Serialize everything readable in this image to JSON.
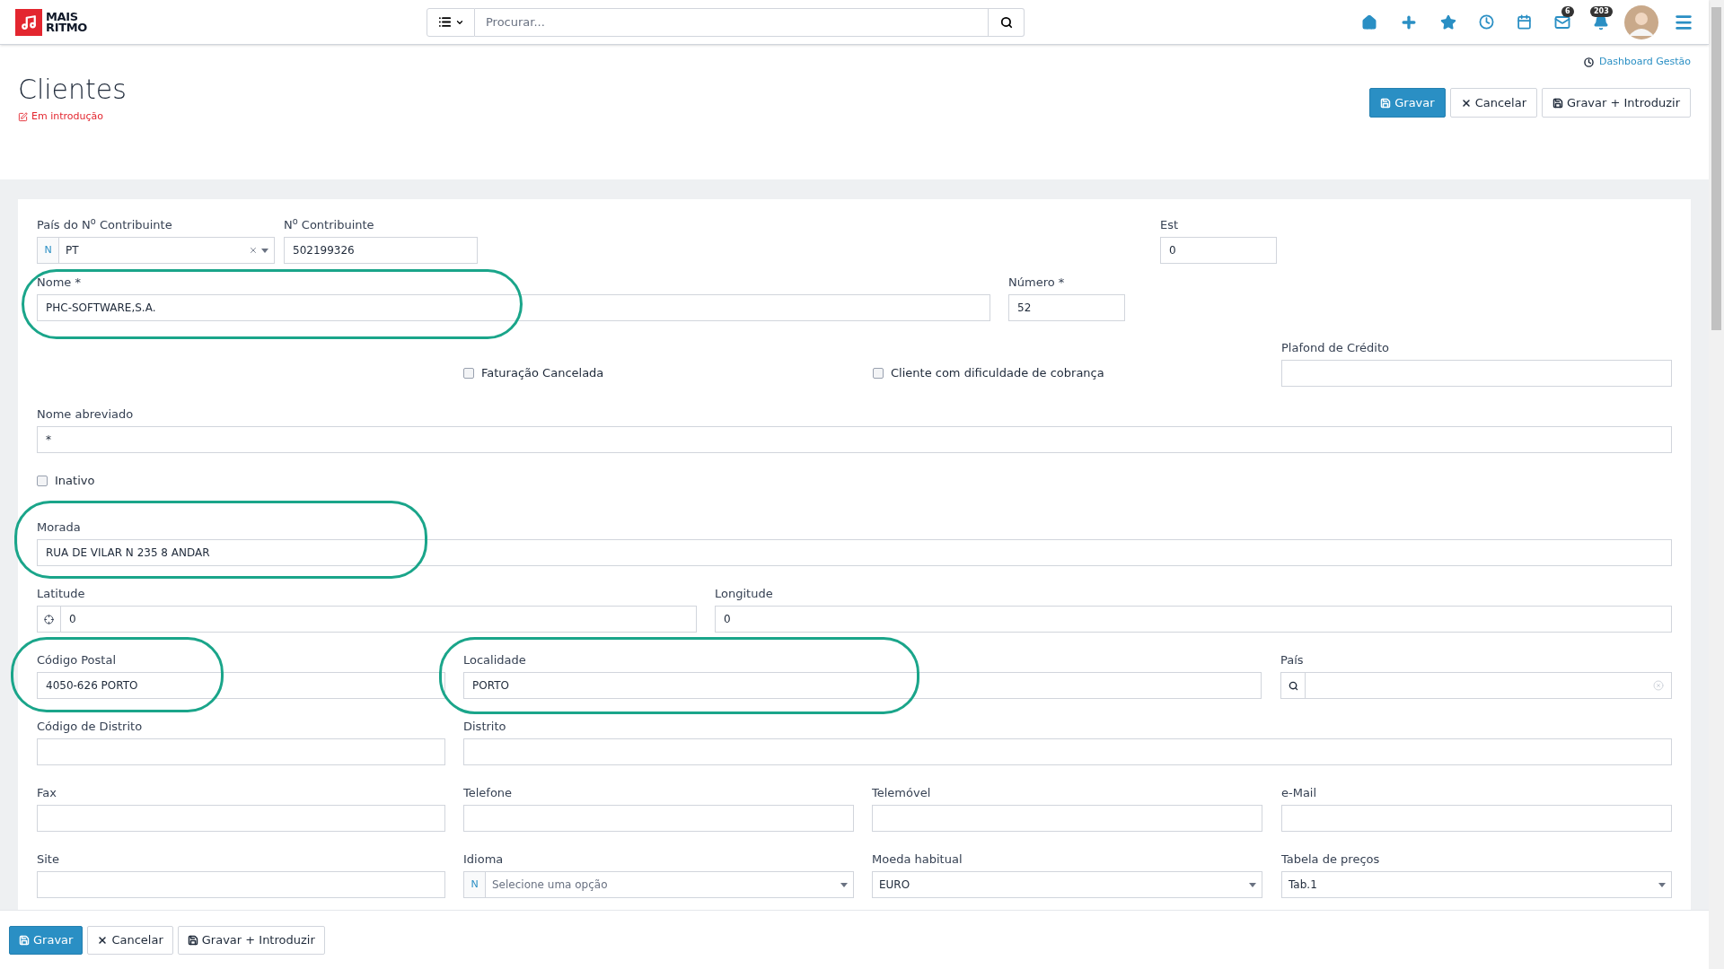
{
  "logo": {
    "line1": "MAIS",
    "line2": "RITMO"
  },
  "search": {
    "placeholder": "Procurar..."
  },
  "toolbar": {
    "mail_badge": "6",
    "notifications_badge": "203"
  },
  "dashboard_link": "Dashboard Gestão",
  "page": {
    "title": "Clientes",
    "status": "Em introdução"
  },
  "actions": [
    {
      "label": "Gravar",
      "kind": "primary"
    },
    {
      "label": "Cancelar",
      "kind": "cancel"
    },
    {
      "label": "Gravar + Introduzir",
      "kind": "save-new"
    }
  ],
  "rows": [
    [
      {
        "kind": "select",
        "label": "País do N$^{o}$ Contribuinte",
        "prefix": "N",
        "value": "PT",
        "clearable": true
      },
      {
        "kind": "text",
        "label": "N$^{o}$ Contribuinte",
        "value": "502199326"
      },
      {
        "kind": "text",
        "label": "Est",
        "value": "0"
      }
    ],
    [
      {
        "kind": "text",
        "label": "Nome *",
        "value": "PHC-SOFTWARE,S.A."
      },
      {
        "kind": "text",
        "label": "Número *",
        "value": "52"
      }
    ],
    [
      {
        "kind": "checkbox",
        "label": "Faturação Cancelada",
        "checked": false
      },
      {
        "kind": "checkbox",
        "label": "Cliente com dificuldade de cobrança",
        "checked": false
      },
      {
        "kind": "text",
        "label": "Plafond de Crédito"
      }
    ],
    [
      {
        "kind": "text",
        "label": "Nome abreviado",
        "value": "*"
      }
    ],
    [
      {
        "kind": "checkbox",
        "label": "Inativo",
        "checked": false
      }
    ],
    [
      {
        "kind": "text",
        "label": "Morada",
        "value": "RUA DE VILAR N 235 8 ANDAR"
      }
    ],
    [
      {
        "kind": "geo",
        "label": "Latitude",
        "value": "0"
      },
      {
        "kind": "text",
        "label": "Longitude",
        "value": "0"
      }
    ],
    [
      {
        "kind": "text",
        "label": "Código Postal",
        "value": "4050-626 PORTO"
      },
      {
        "kind": "text",
        "label": "Localidade",
        "value": "PORTO"
      },
      {
        "kind": "lookup",
        "label": "País"
      }
    ],
    [
      {
        "kind": "text",
        "label": "Código de Distrito"
      },
      {
        "kind": "text",
        "label": "Distrito"
      }
    ],
    [
      {
        "kind": "text",
        "label": "Fax"
      },
      {
        "kind": "text",
        "label": "Telefone"
      },
      {
        "kind": "text",
        "label": "Telemóvel"
      },
      {
        "kind": "text",
        "label": "e-Mail"
      }
    ],
    [
      {
        "kind": "text",
        "label": "Site"
      },
      {
        "kind": "select",
        "label": "Idioma",
        "prefix": "N",
        "placeholder": "Selecione uma opção"
      },
      {
        "kind": "select",
        "label": "Moeda habitual",
        "value": "EURO"
      },
      {
        "kind": "select",
        "label": "Tabela de preços",
        "value": "Tab.1"
      }
    ]
  ],
  "bottom_actions": [
    {
      "label": "Gravar",
      "kind": "primary"
    },
    {
      "label": "Cancelar",
      "kind": "cancel"
    },
    {
      "label": "Gravar + Introduzir",
      "kind": "save-new"
    }
  ]
}
